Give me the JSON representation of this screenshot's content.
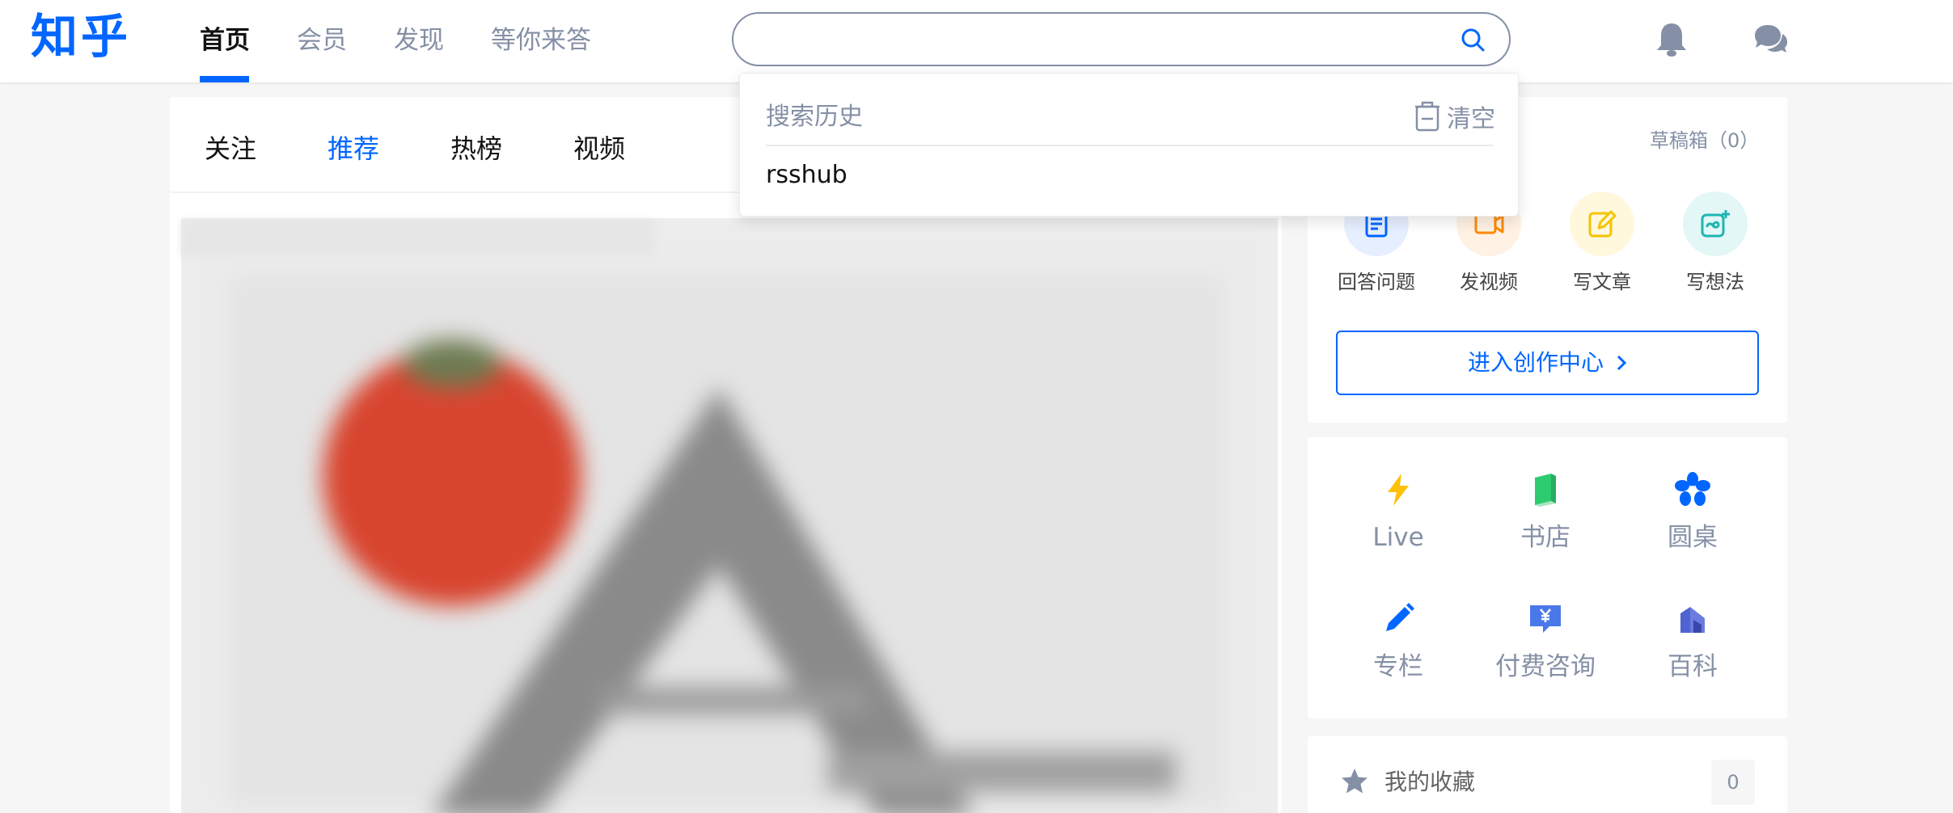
{
  "header": {
    "logo": "知乎",
    "nav": [
      "首页",
      "会员",
      "发现",
      "等你来答"
    ],
    "search": {
      "placeholder": ""
    }
  },
  "feed": {
    "tabs": [
      "关注",
      "推荐",
      "热榜",
      "视频"
    ],
    "active_tab": "推荐"
  },
  "search_dropdown": {
    "title": "搜索历史",
    "clear_label": "清空",
    "history": [
      "rsshub"
    ]
  },
  "create": {
    "drafts_label": "草稿箱（0）",
    "items": [
      {
        "label": "回答问题",
        "icon": "answer-icon",
        "color": "#0066ff"
      },
      {
        "label": "发视频",
        "icon": "video-icon",
        "color": "#ff8a00"
      },
      {
        "label": "写文章",
        "icon": "article-icon",
        "color": "#f5c400"
      },
      {
        "label": "写想法",
        "icon": "idea-icon",
        "color": "#1fb6b1"
      }
    ],
    "creator_center_label": "进入创作中心"
  },
  "services": [
    {
      "label": "Live",
      "icon": "lightning-icon",
      "color": "#ffc107"
    },
    {
      "label": "书店",
      "icon": "book-icon",
      "color": "#2ecc71"
    },
    {
      "label": "圆桌",
      "icon": "roundtable-icon",
      "color": "#0066ff"
    },
    {
      "label": "专栏",
      "icon": "pen-icon",
      "color": "#0066ff"
    },
    {
      "label": "付费咨询",
      "icon": "paid-consult-icon",
      "color": "#4a78e8"
    },
    {
      "label": "百科",
      "icon": "wiki-icon",
      "color": "#4f63d2"
    }
  ],
  "favorites": {
    "label": "我的收藏",
    "count": "0"
  }
}
